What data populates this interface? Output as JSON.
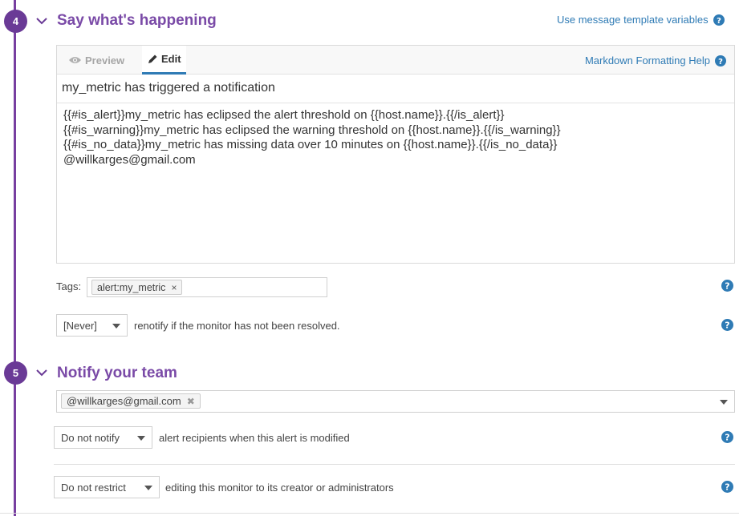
{
  "section4": {
    "step": "4",
    "title": "Say what's happening",
    "template_link": "Use message template variables",
    "tabs": {
      "preview": "Preview",
      "edit": "Edit"
    },
    "markdown_help": "Markdown Formatting Help",
    "subject": "my_metric has triggered a notification",
    "body_lines": [
      "{{#is_alert}}my_metric has eclipsed the alert threshold on {{host.name}}.{{/is_alert}}",
      "{{#is_warning}}my_metric has eclipsed the warning threshold on {{host.name}}.{{/is_warning}}",
      "{{#is_no_data}}my_metric has missing data over 10 minutes on {{host.name}}.{{/is_no_data}}",
      "@willkarges@gmail.com"
    ],
    "tags_label": "Tags:",
    "tag": "alert:my_metric",
    "tag_remove": "×",
    "renotify_value": "[Never]",
    "renotify_text": "renotify if the monitor has not been resolved."
  },
  "section5": {
    "step": "5",
    "title": "Notify your team",
    "recipient": "@willkarges@gmail.com",
    "recipient_remove": "✖",
    "notify_value": "Do not notify",
    "notify_text": "alert recipients when this alert is modified",
    "restrict_value": "Do not restrict",
    "restrict_text": "editing this monitor to its creator or administrators"
  },
  "colors": {
    "accent": "#7a4aa7",
    "link": "#2f7bb5",
    "rail": "#773fa0"
  }
}
